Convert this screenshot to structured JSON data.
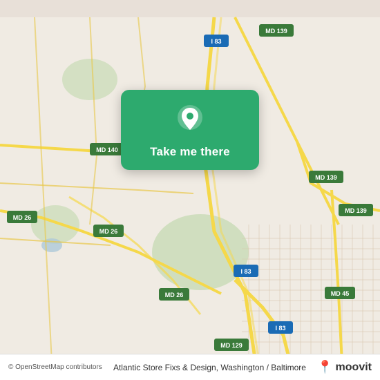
{
  "map": {
    "background_color": "#f2ede6",
    "attribution": "© OpenStreetMap contributors",
    "location_label": "Atlantic Store Fixs & Design, Washington / Baltimore",
    "moovit_brand": "moovit"
  },
  "card": {
    "button_label": "Take me there",
    "pin_icon": "location-pin"
  },
  "road_labels": [
    {
      "id": "i83_top",
      "text": "I 83"
    },
    {
      "id": "md139_top",
      "text": "MD 139"
    },
    {
      "id": "md140",
      "text": "MD 140"
    },
    {
      "id": "md139_mid",
      "text": "MD 139"
    },
    {
      "id": "md139_right",
      "text": "MD 139"
    },
    {
      "id": "md26_left",
      "text": "MD 26"
    },
    {
      "id": "md26_mid",
      "text": "MD 26"
    },
    {
      "id": "md26_bottom",
      "text": "MD 26"
    },
    {
      "id": "i83_mid",
      "text": "I 83"
    },
    {
      "id": "i83_bottom",
      "text": "I 83"
    },
    {
      "id": "md45",
      "text": "MD 45"
    },
    {
      "id": "md129",
      "text": "MD 129"
    }
  ]
}
